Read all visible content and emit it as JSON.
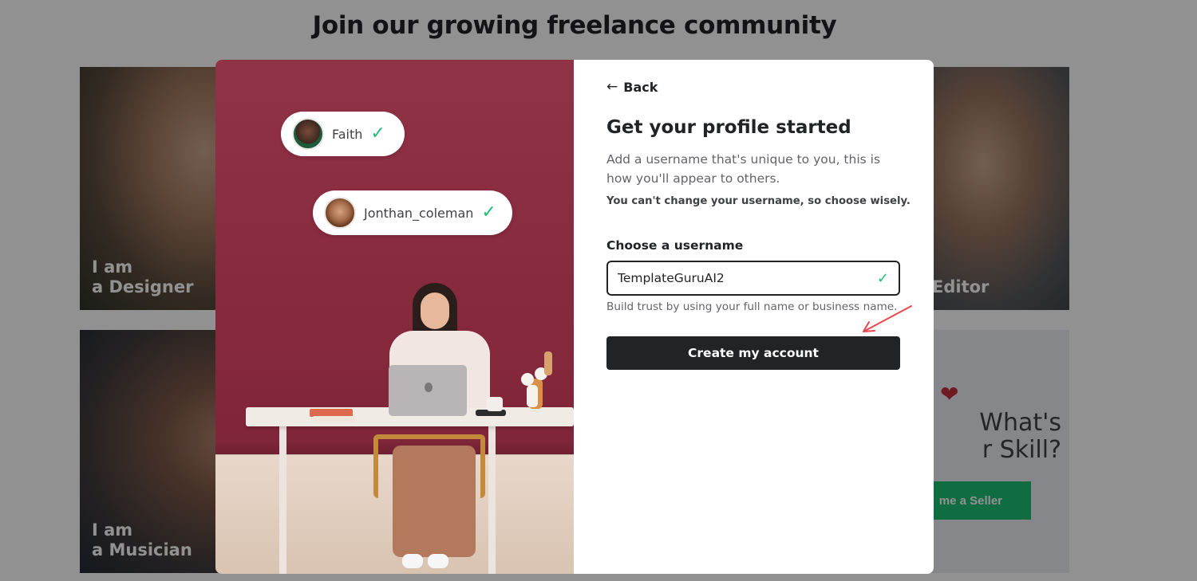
{
  "background": {
    "heading": "Join our growing freelance community",
    "cards": {
      "designer": "I am\na Designer",
      "musician": "I am\na Musician",
      "editor": "Editor"
    },
    "skill_card": {
      "question": "What's\nr Skill?",
      "button": "me a Seller",
      "heart_icon": "heart-icon"
    }
  },
  "modal": {
    "illustration": {
      "chips": [
        {
          "name": "Faith",
          "verified": true
        },
        {
          "name": "Jonthan_coleman",
          "verified": true
        }
      ]
    },
    "back_label": "Back",
    "title": "Get your profile started",
    "subtitle": "Add a username that's unique to you, this is how you'll appear to others.",
    "warning": "You can't change your username, so choose wisely.",
    "field_label": "Choose a username",
    "username_value": "TemplateGuruAI2",
    "hint": "Build trust by using your full name or business name.",
    "submit_label": "Create my account"
  },
  "colors": {
    "accent_green": "#1dbf73",
    "dark_button": "#222325",
    "illustration_wall": "#8a2c40",
    "annotation_arrow": "#e8474b"
  }
}
